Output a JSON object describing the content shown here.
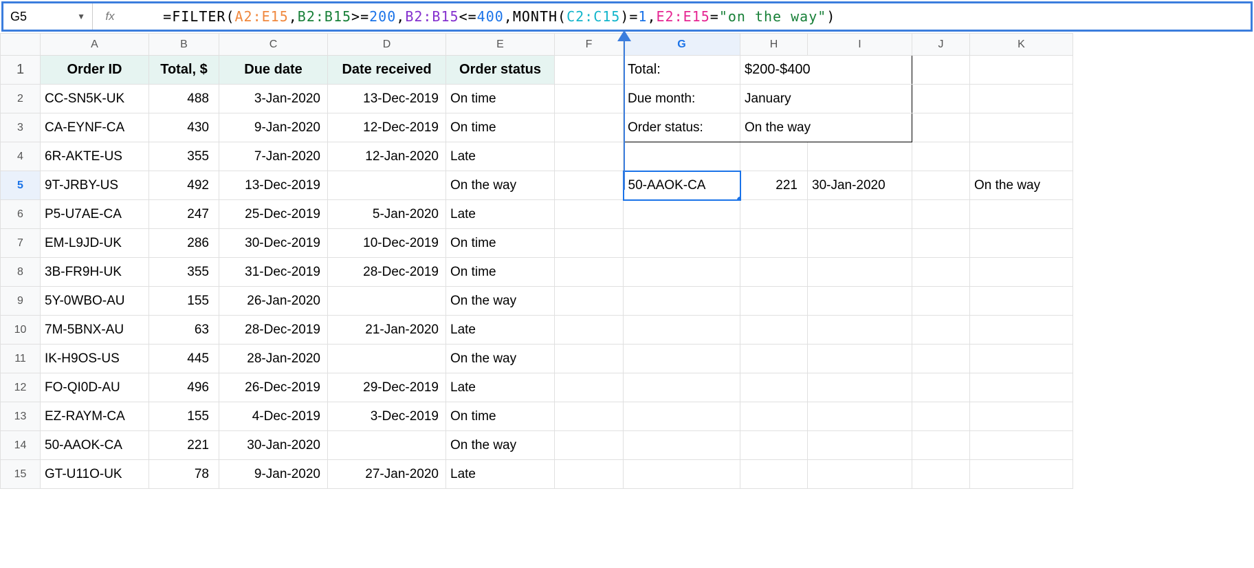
{
  "namebox": "G5",
  "fx_label": "fx",
  "formula": {
    "p1": "=FILTER(",
    "r1": "A2:E15",
    "c1": ",",
    "r2": "B2:B15",
    "op2": ">=",
    "n2": "200",
    "c2": ",",
    "r3": "B2:B15",
    "op3": "<=",
    "n3": "400",
    "c3": ",",
    "mfn": "MONTH(",
    "r4": "C2:C15",
    "mclose": ")",
    "eq1": "=",
    "n4": "1",
    "c4": ",",
    "r5": "E2:E15",
    "eq2": "=",
    "str": "\"on the way\"",
    "close": ")"
  },
  "colHeaders": [
    "A",
    "B",
    "C",
    "D",
    "E",
    "F",
    "G",
    "H",
    "I",
    "J",
    "K"
  ],
  "rowHeaders": [
    "1",
    "2",
    "3",
    "4",
    "5",
    "6",
    "7",
    "8",
    "9",
    "10",
    "11",
    "12",
    "13",
    "14",
    "15"
  ],
  "tableHeaders": {
    "A": "Order ID",
    "B": "Total, $",
    "C": "Due date",
    "D": "Date received",
    "E": "Order status"
  },
  "rows": [
    {
      "A": "CC-SN5K-UK",
      "B": "488",
      "C": "3-Jan-2020",
      "D": "13-Dec-2019",
      "E": "On time"
    },
    {
      "A": "CA-EYNF-CA",
      "B": "430",
      "C": "9-Jan-2020",
      "D": "12-Dec-2019",
      "E": "On time"
    },
    {
      "A": "6R-AKTE-US",
      "B": "355",
      "C": "7-Jan-2020",
      "D": "12-Jan-2020",
      "E": "Late"
    },
    {
      "A": "9T-JRBY-US",
      "B": "492",
      "C": "13-Dec-2019",
      "D": "",
      "E": "On the way"
    },
    {
      "A": "P5-U7AE-CA",
      "B": "247",
      "C": "25-Dec-2019",
      "D": "5-Jan-2020",
      "E": "Late"
    },
    {
      "A": "EM-L9JD-UK",
      "B": "286",
      "C": "30-Dec-2019",
      "D": "10-Dec-2019",
      "E": "On time"
    },
    {
      "A": "3B-FR9H-UK",
      "B": "355",
      "C": "31-Dec-2019",
      "D": "28-Dec-2019",
      "E": "On time"
    },
    {
      "A": "5Y-0WBO-AU",
      "B": "155",
      "C": "26-Jan-2020",
      "D": "",
      "E": "On the way"
    },
    {
      "A": "7M-5BNX-AU",
      "B": "63",
      "C": "28-Dec-2019",
      "D": "21-Jan-2020",
      "E": "Late"
    },
    {
      "A": "IK-H9OS-US",
      "B": "445",
      "C": "28-Jan-2020",
      "D": "",
      "E": "On the way"
    },
    {
      "A": "FO-QI0D-AU",
      "B": "496",
      "C": "26-Dec-2019",
      "D": "29-Dec-2019",
      "E": "Late"
    },
    {
      "A": "EZ-RAYM-CA",
      "B": "155",
      "C": "4-Dec-2019",
      "D": "3-Dec-2019",
      "E": "On time"
    },
    {
      "A": "50-AAOK-CA",
      "B": "221",
      "C": "30-Jan-2020",
      "D": "",
      "E": "On the way"
    },
    {
      "A": "GT-U11O-UK",
      "B": "78",
      "C": "9-Jan-2020",
      "D": "27-Jan-2020",
      "E": "Late"
    }
  ],
  "criteria": {
    "l1": "Total:",
    "v1": "$200-$400",
    "l2": "Due month:",
    "v2": "January",
    "l3": "Order status:",
    "v3": "On the way"
  },
  "result": {
    "G": "50-AAOK-CA",
    "H": "221",
    "I": "30-Jan-2020",
    "J": "",
    "K": "On the way"
  }
}
